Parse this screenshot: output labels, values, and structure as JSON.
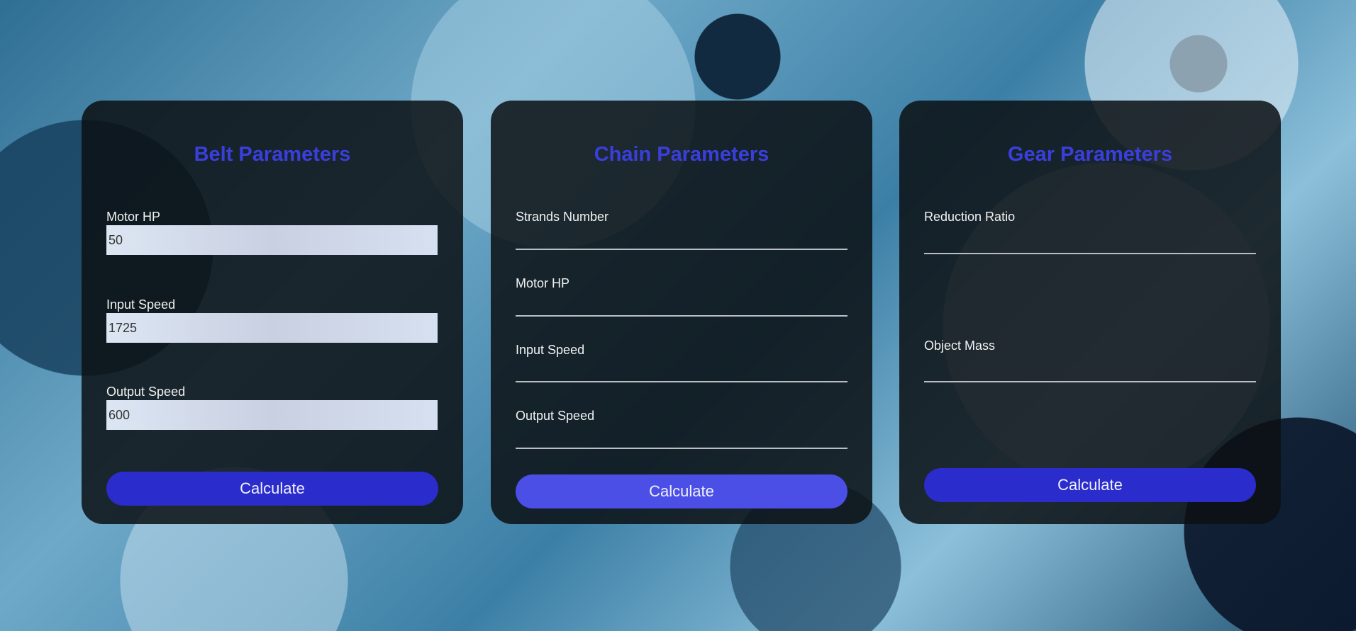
{
  "belt": {
    "title": "Belt Parameters",
    "fields": [
      {
        "label": "Motor HP",
        "value": "50"
      },
      {
        "label": "Input Speed",
        "value": "1725"
      },
      {
        "label": "Output Speed",
        "value": "600"
      }
    ],
    "button": "Calculate"
  },
  "chain": {
    "title": "Chain Parameters",
    "fields": [
      {
        "label": "Strands Number",
        "value": ""
      },
      {
        "label": "Motor HP",
        "value": ""
      },
      {
        "label": "Input Speed",
        "value": ""
      },
      {
        "label": "Output Speed",
        "value": ""
      }
    ],
    "button": "Calculate"
  },
  "gear": {
    "title": "Gear Parameters",
    "fields": [
      {
        "label": "Reduction Ratio",
        "value": ""
      },
      {
        "label": "Object Mass",
        "value": ""
      }
    ],
    "button": "Calculate"
  },
  "colors": {
    "title_accent": "#3a3fdc",
    "button_primary": "#2a2ccc",
    "button_chain": "#4b4fe6",
    "panel_bg": "#0c1014"
  }
}
